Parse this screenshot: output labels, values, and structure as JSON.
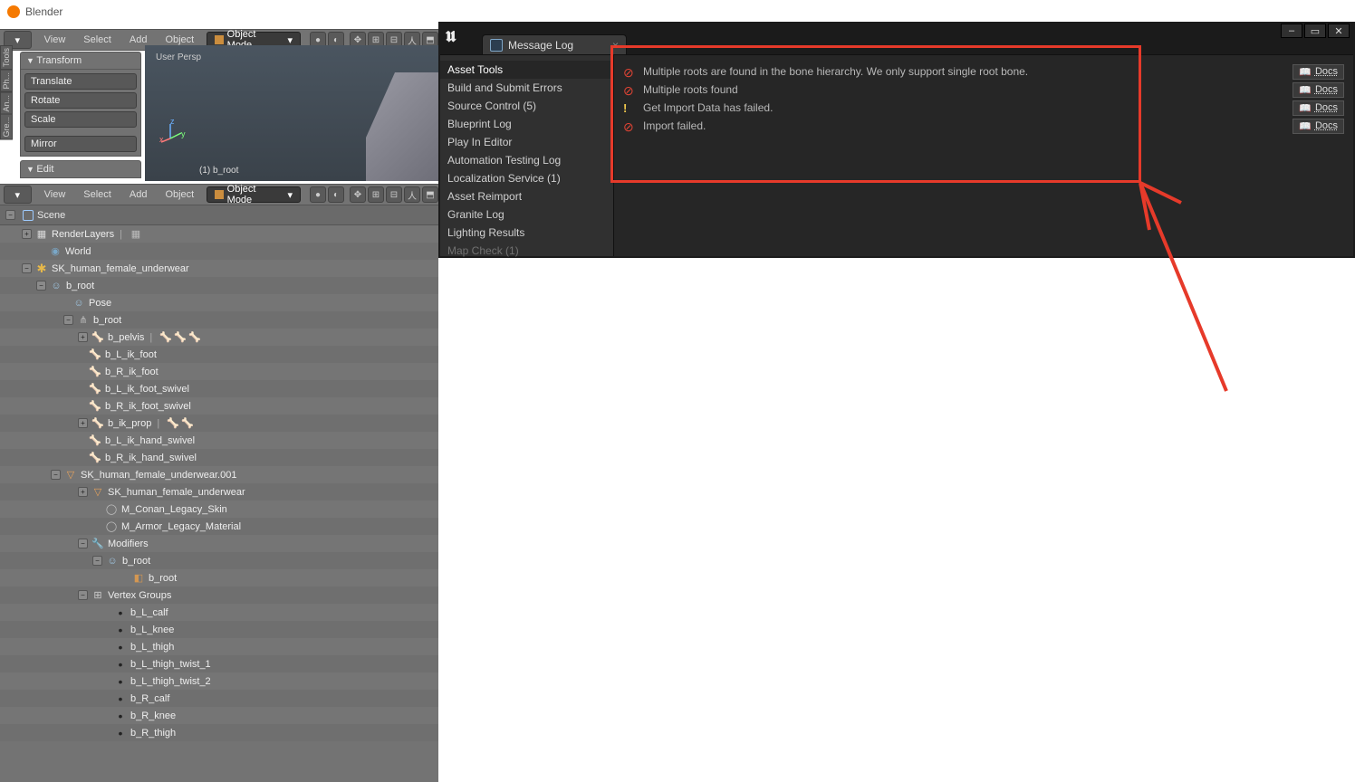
{
  "blender": {
    "title": "Blender",
    "menu_top": [
      "View",
      "Select",
      "Add",
      "Object"
    ],
    "mode": "Object Mode",
    "transform_hdr": "Transform",
    "transform_btns": [
      "Translate",
      "Rotate",
      "Scale",
      "Mirror"
    ],
    "edit_hdr": "Edit",
    "left_tabs": [
      "Gre...",
      "An...",
      "Ph...",
      "Tools"
    ],
    "viewport": {
      "persp": "User Persp",
      "obj": "(1) b_root"
    },
    "outliner_hdr": "Scene",
    "tree": {
      "renderLayers": "RenderLayers",
      "world": "World",
      "sk": "SK_human_female_underwear",
      "broot": "b_root",
      "pose": "Pose",
      "broot2": "b_root",
      "pelvis": "b_pelvis",
      "l_ik_foot": "b_L_ik_foot",
      "r_ik_foot": "b_R_ik_foot",
      "l_ik_foot_sw": "b_L_ik_foot_swivel",
      "r_ik_foot_sw": "b_R_ik_foot_swivel",
      "ik_prop": "b_ik_prop",
      "l_ik_hand_sw": "b_L_ik_hand_swivel",
      "r_ik_hand_sw": "b_R_ik_hand_swivel",
      "sk001": "SK_human_female_underwear.001",
      "sk_mesh": "SK_human_female_underwear",
      "mat1": "M_Conan_Legacy_Skin",
      "mat2": "M_Armor_Legacy_Material",
      "modifiers": "Modifiers",
      "mod_broot": "b_root",
      "mod_broot2": "b_root",
      "vg": "Vertex Groups",
      "vg_items": [
        "b_L_calf",
        "b_L_knee",
        "b_L_thigh",
        "b_L_thigh_twist_1",
        "b_L_thigh_twist_2",
        "b_R_calf",
        "b_R_knee",
        "b_R_thigh"
      ]
    }
  },
  "ue": {
    "tab": "Message Log",
    "categories": [
      "Asset Tools",
      "Build and Submit Errors",
      "Source Control (5)",
      "Blueprint Log",
      "Play In Editor",
      "Automation Testing Log",
      "Localization Service (1)",
      "Asset Reimport",
      "Granite Log",
      "Lighting Results",
      "Map Check (1)"
    ],
    "docs_label": "Docs",
    "messages": [
      {
        "type": "err",
        "text": "Multiple roots are found in the bone hierarchy. We only support single root bone."
      },
      {
        "type": "err",
        "text": "Multiple roots found"
      },
      {
        "type": "warn",
        "text": "Get Import Data has failed."
      },
      {
        "type": "err",
        "text": "Import failed."
      }
    ]
  }
}
